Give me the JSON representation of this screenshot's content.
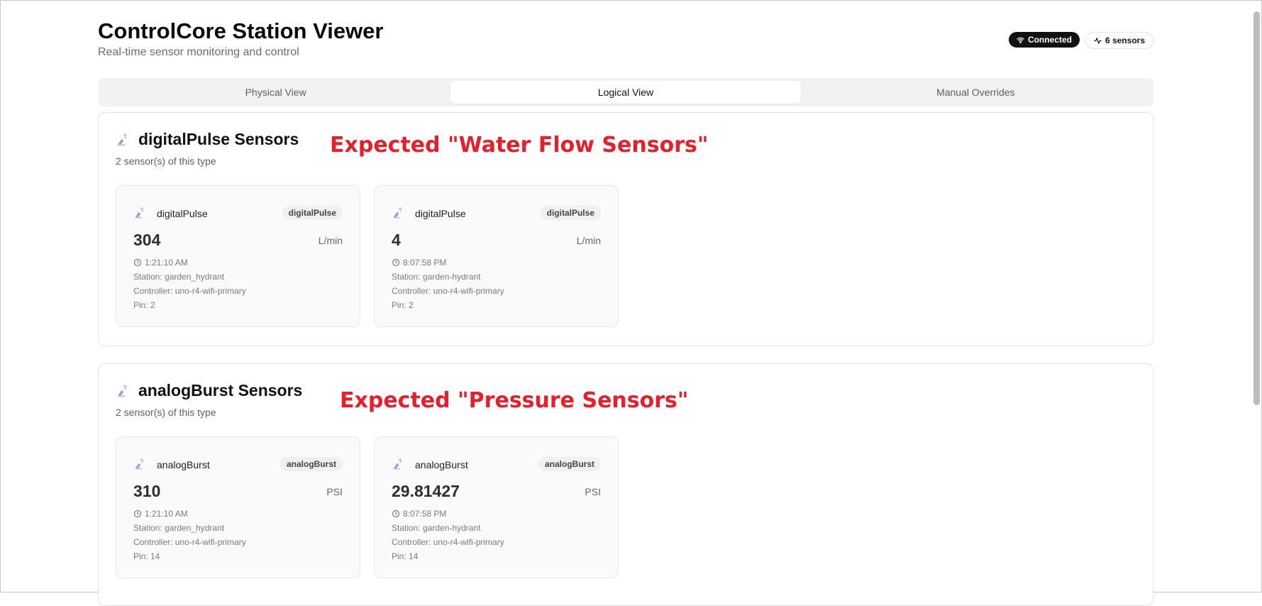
{
  "header": {
    "title": "ControlCore Station Viewer",
    "subtitle": "Real-time sensor monitoring and control",
    "status_connected": "Connected",
    "sensor_count": "6 sensors"
  },
  "tabs": [
    {
      "label": "Physical View",
      "active": false
    },
    {
      "label": "Logical View",
      "active": true
    },
    {
      "label": "Manual Overrides",
      "active": false
    }
  ],
  "colors": {
    "annotation": "#e3202b",
    "accent_dark": "#111111"
  },
  "sections": [
    {
      "title": "digitalPulse Sensors",
      "count": "2 sensor(s) of this type",
      "annotation": "Expected \"Water Flow Sensors\"",
      "icon": "sensor-icon",
      "cards": [
        {
          "name": "digitalPulse",
          "badge": "digitalPulse",
          "value": "304",
          "unit": "L/min",
          "time": "1:21:10 AM",
          "station": "Station: garden_hydrant",
          "controller": "Controller: uno-r4-wifi-primary",
          "pin": "Pin: 2"
        },
        {
          "name": "digitalPulse",
          "badge": "digitalPulse",
          "value": "4",
          "unit": "L/min",
          "time": "8:07:58 PM",
          "station": "Station: garden-hydrant",
          "controller": "Controller: uno-r4-wifi-primary",
          "pin": "Pin: 2"
        }
      ]
    },
    {
      "title": "analogBurst Sensors",
      "count": "2 sensor(s) of this type",
      "annotation": "Expected \"Pressure Sensors\"",
      "icon": "sensor-icon",
      "cards": [
        {
          "name": "analogBurst",
          "badge": "analogBurst",
          "value": "310",
          "unit": "PSI",
          "time": "1:21:10 AM",
          "station": "Station: garden_hydrant",
          "controller": "Controller: uno-r4-wifi-primary",
          "pin": "Pin: 14"
        },
        {
          "name": "analogBurst",
          "badge": "analogBurst",
          "value": "29.81427",
          "unit": "PSI",
          "time": "8:07:58 PM",
          "station": "Station: garden-hydrant",
          "controller": "Controller: uno-r4-wifi-primary",
          "pin": "Pin: 14"
        }
      ]
    }
  ]
}
